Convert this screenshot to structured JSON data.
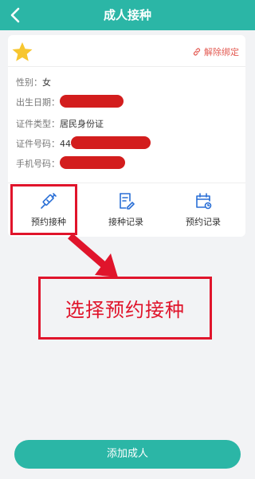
{
  "header": {
    "title": "成人接种",
    "back_icon": "chevron-left-icon"
  },
  "card": {
    "unbind_label": "解除绑定",
    "fields": [
      {
        "label": "性别：",
        "value": "女"
      },
      {
        "label": "出生日期：",
        "value": ""
      },
      {
        "label": "证件类型：",
        "value": "居民身份证"
      },
      {
        "label": "证件号码：",
        "value": "44"
      },
      {
        "label": "手机号码：",
        "value": ""
      }
    ]
  },
  "actions": [
    {
      "label": "预约接种",
      "icon": "syringe-icon"
    },
    {
      "label": "接种记录",
      "icon": "record-icon"
    },
    {
      "label": "预约记录",
      "icon": "calendar-icon"
    }
  ],
  "annotation": {
    "callout_text": "选择预约接种"
  },
  "footer": {
    "add_button_label": "添加成人"
  },
  "colors": {
    "primary": "#2bb6a6",
    "annotation_red": "#e0142b",
    "unbind": "#e35a52",
    "star": "#f7c62f"
  }
}
